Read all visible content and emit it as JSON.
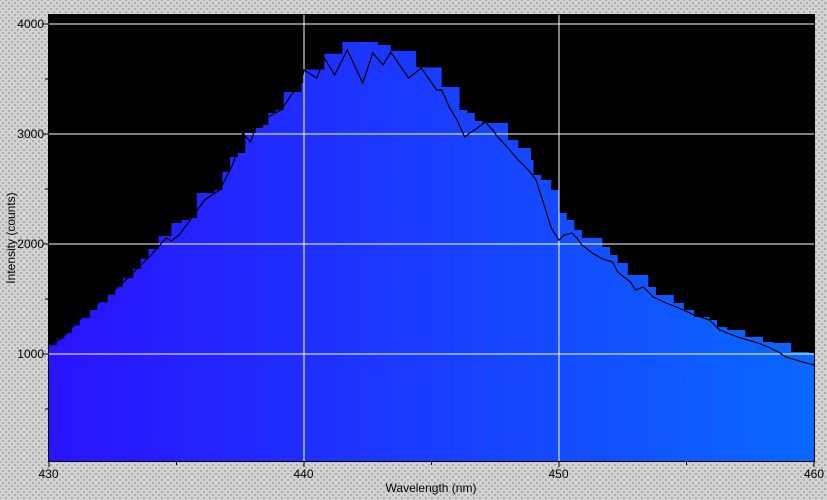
{
  "chart_data": {
    "type": "area",
    "title": "",
    "xlabel": "Wavelength (nm)",
    "ylabel": "Intensity (counts)",
    "xlim": [
      430,
      460
    ],
    "ylim": [
      0,
      4100
    ],
    "grid": true,
    "legend_position": "none",
    "plot_background": "#000000",
    "window_background": "#d2d2d2",
    "gridlines": {
      "color": "#ffffff",
      "x": [
        440,
        450
      ],
      "y": [
        1000,
        2000,
        3000,
        4000
      ]
    },
    "x_axis": {
      "major_ticks": [
        430,
        440,
        450,
        460
      ],
      "minor_ticks": [
        435,
        445,
        455
      ],
      "labels": [
        "430",
        "440",
        "450",
        "460"
      ]
    },
    "y_axis": {
      "major_ticks": [
        1000,
        2000,
        3000,
        4000
      ],
      "minor_ticks": [
        500,
        1500,
        2500,
        3500
      ],
      "labels": [
        "1000",
        "2000",
        "3000",
        "4000"
      ]
    },
    "series": [
      {
        "name": "spectrum histogram fill",
        "type": "step-area",
        "fill_gradient": [
          "#2a12ff",
          "#0968ff"
        ],
        "points": [
          [
            430.0,
            1080
          ],
          [
            430.3,
            1140
          ],
          [
            430.6,
            1190
          ],
          [
            430.9,
            1260
          ],
          [
            431.2,
            1330
          ],
          [
            431.6,
            1400
          ],
          [
            431.9,
            1470
          ],
          [
            432.3,
            1540
          ],
          [
            432.6,
            1610
          ],
          [
            432.9,
            1690
          ],
          [
            433.3,
            1775
          ],
          [
            433.6,
            1865
          ],
          [
            433.9,
            1955
          ],
          [
            434.3,
            2073
          ],
          [
            434.8,
            2191
          ],
          [
            435.2,
            2218
          ],
          [
            435.5,
            2236
          ],
          [
            435.8,
            2464
          ],
          [
            436.5,
            2491
          ],
          [
            436.8,
            2655
          ],
          [
            437.1,
            2791
          ],
          [
            437.4,
            2827
          ],
          [
            437.7,
            3009
          ],
          [
            438.1,
            3055
          ],
          [
            438.4,
            3082
          ],
          [
            438.6,
            3191
          ],
          [
            438.9,
            3218
          ],
          [
            439.2,
            3382
          ],
          [
            439.9,
            3464
          ],
          [
            440.0,
            3586
          ],
          [
            440.8,
            3730
          ],
          [
            441.5,
            3836
          ],
          [
            442.9,
            3809
          ],
          [
            443.4,
            3755
          ],
          [
            444.4,
            3605
          ],
          [
            445.4,
            3427
          ],
          [
            446.1,
            3218
          ],
          [
            446.4,
            3191
          ],
          [
            446.7,
            3118
          ],
          [
            447.0,
            3100
          ],
          [
            448.0,
            2945
          ],
          [
            448.4,
            2873
          ],
          [
            448.9,
            2764
          ],
          [
            449.0,
            2627
          ],
          [
            449.3,
            2582
          ],
          [
            449.7,
            2491
          ],
          [
            450.0,
            2282
          ],
          [
            450.3,
            2218
          ],
          [
            450.6,
            2127
          ],
          [
            450.9,
            2055
          ],
          [
            451.7,
            1973
          ],
          [
            452.0,
            1900
          ],
          [
            452.3,
            1827
          ],
          [
            452.7,
            1718
          ],
          [
            453.5,
            1609
          ],
          [
            453.8,
            1536
          ],
          [
            454.5,
            1464
          ],
          [
            454.9,
            1400
          ],
          [
            455.3,
            1336
          ],
          [
            455.9,
            1309
          ],
          [
            456.2,
            1245
          ],
          [
            456.6,
            1218
          ],
          [
            457.3,
            1155
          ],
          [
            458.0,
            1109
          ],
          [
            458.4,
            1100
          ],
          [
            459.1,
            1018
          ],
          [
            459.8,
            1009
          ]
        ]
      },
      {
        "name": "spectrum trace line",
        "type": "line",
        "color": "#000000",
        "points": [
          [
            430.0,
            1082
          ],
          [
            430.5,
            1145
          ],
          [
            431.0,
            1264
          ],
          [
            431.6,
            1400
          ],
          [
            432.2,
            1518
          ],
          [
            432.8,
            1627
          ],
          [
            433.4,
            1764
          ],
          [
            434.0,
            1900
          ],
          [
            434.6,
            2055
          ],
          [
            434.8,
            2027
          ],
          [
            435.1,
            2082
          ],
          [
            435.6,
            2236
          ],
          [
            436.1,
            2400
          ],
          [
            436.7,
            2491
          ],
          [
            437.2,
            2718
          ],
          [
            437.6,
            3009
          ],
          [
            437.9,
            2927
          ],
          [
            438.1,
            3055
          ],
          [
            438.6,
            3155
          ],
          [
            439.1,
            3218
          ],
          [
            439.5,
            3355
          ],
          [
            439.9,
            3464
          ],
          [
            440.0,
            3582
          ],
          [
            440.5,
            3509
          ],
          [
            440.8,
            3691
          ],
          [
            441.2,
            3536
          ],
          [
            441.7,
            3764
          ],
          [
            442.3,
            3464
          ],
          [
            442.7,
            3736
          ],
          [
            443.1,
            3627
          ],
          [
            443.4,
            3745
          ],
          [
            444.1,
            3509
          ],
          [
            444.6,
            3600
          ],
          [
            445.2,
            3400
          ],
          [
            445.4,
            3400
          ],
          [
            445.7,
            3245
          ],
          [
            446.0,
            3127
          ],
          [
            446.3,
            2973
          ],
          [
            446.5,
            3009
          ],
          [
            446.7,
            3036
          ],
          [
            447.1,
            3109
          ],
          [
            447.4,
            3036
          ],
          [
            447.6,
            2973
          ],
          [
            448.0,
            2873
          ],
          [
            448.4,
            2764
          ],
          [
            448.8,
            2673
          ],
          [
            449.1,
            2582
          ],
          [
            449.5,
            2291
          ],
          [
            449.7,
            2145
          ],
          [
            450.0,
            2036
          ],
          [
            450.2,
            2082
          ],
          [
            450.5,
            2100
          ],
          [
            450.7,
            2055
          ],
          [
            450.9,
            1991
          ],
          [
            451.3,
            1918
          ],
          [
            451.7,
            1864
          ],
          [
            452.1,
            1836
          ],
          [
            452.3,
            1745
          ],
          [
            452.8,
            1655
          ],
          [
            453.0,
            1582
          ],
          [
            453.3,
            1609
          ],
          [
            453.7,
            1518
          ],
          [
            454.2,
            1464
          ],
          [
            454.7,
            1418
          ],
          [
            455.3,
            1355
          ],
          [
            455.9,
            1309
          ],
          [
            456.3,
            1218
          ],
          [
            456.6,
            1191
          ],
          [
            457.0,
            1155
          ],
          [
            457.4,
            1127
          ],
          [
            457.8,
            1100
          ],
          [
            458.2,
            1064
          ],
          [
            458.6,
            1018
          ],
          [
            458.9,
            973
          ],
          [
            459.3,
            945
          ],
          [
            459.7,
            918
          ],
          [
            460.0,
            900
          ]
        ]
      }
    ]
  }
}
